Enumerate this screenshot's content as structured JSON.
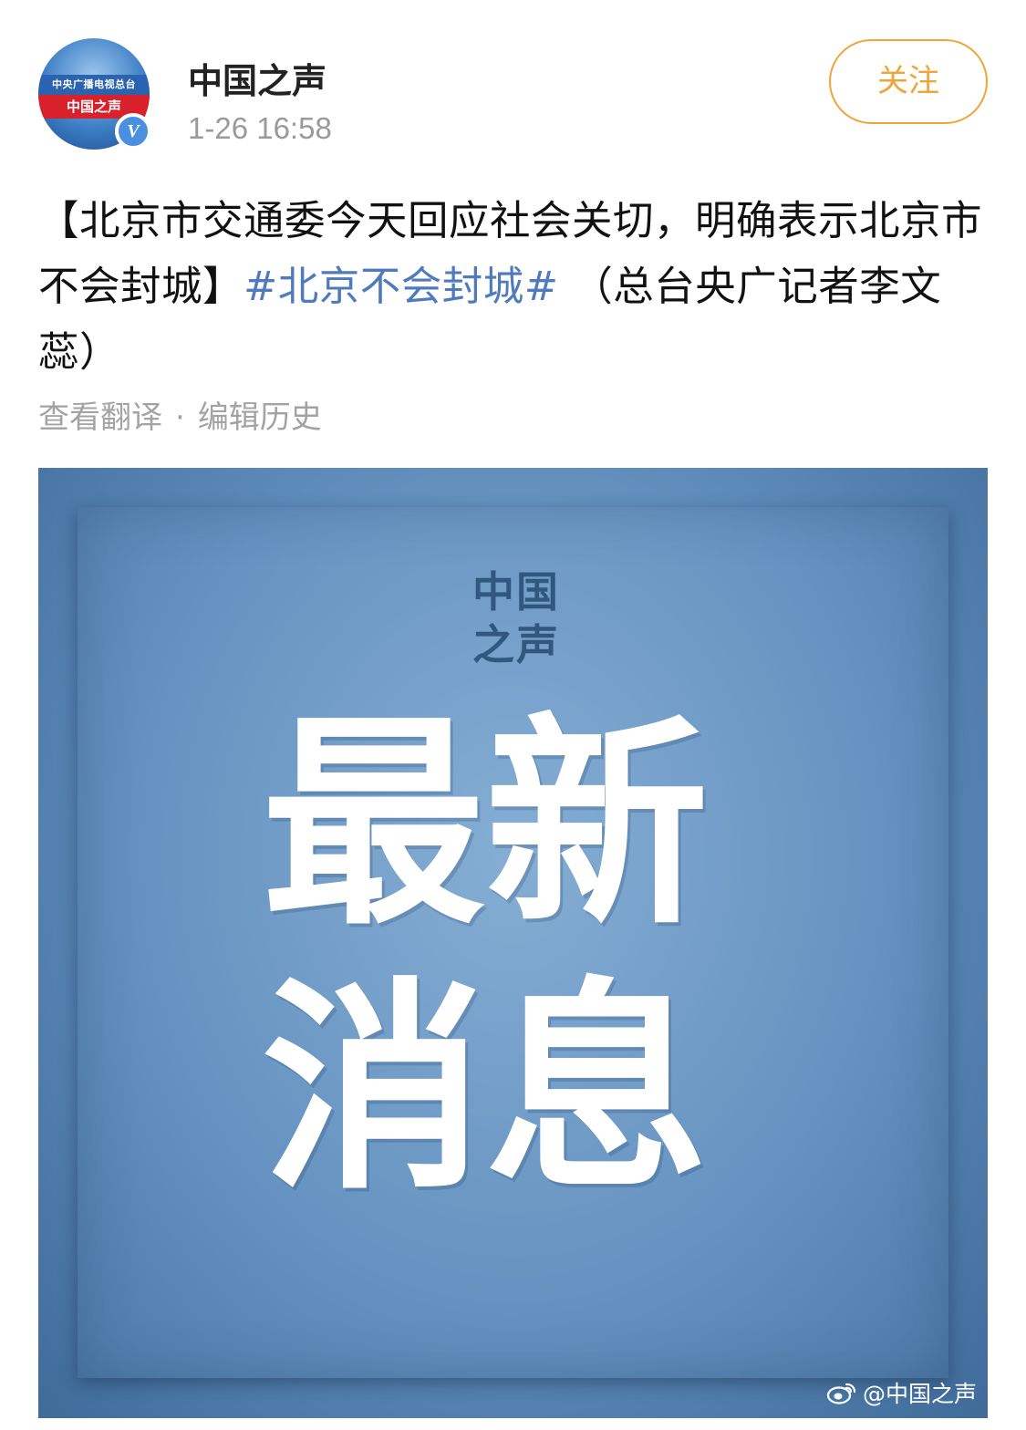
{
  "header": {
    "avatar_line1": "中央广播电视总台",
    "avatar_line2": "中国之声",
    "verified_mark": "V",
    "account_name": "中国之声",
    "timestamp": "1-26 16:58",
    "follow_label": "关注"
  },
  "post": {
    "text_before": "【北京市交通委今天回应社会关切，明确表示北京市不会封城】",
    "hashtag": "#北京不会封城#",
    "text_after": " （总台央广记者李文蕊）",
    "translate_label": "查看翻译",
    "separator": "·",
    "edit_history_label": "编辑历史"
  },
  "image": {
    "logo_text": "中国之声",
    "headline_line1": "最新",
    "headline_line2": "消息",
    "watermark": "@中国之声"
  },
  "colors": {
    "accent_orange": "#f0a43a",
    "hashtag_blue": "#4f7bbd",
    "meta_gray": "#a3a3a3",
    "image_blue": "#6592c0"
  },
  "icons": {
    "verified": "verified-badge-icon",
    "watermark": "weibo-logo-icon"
  }
}
